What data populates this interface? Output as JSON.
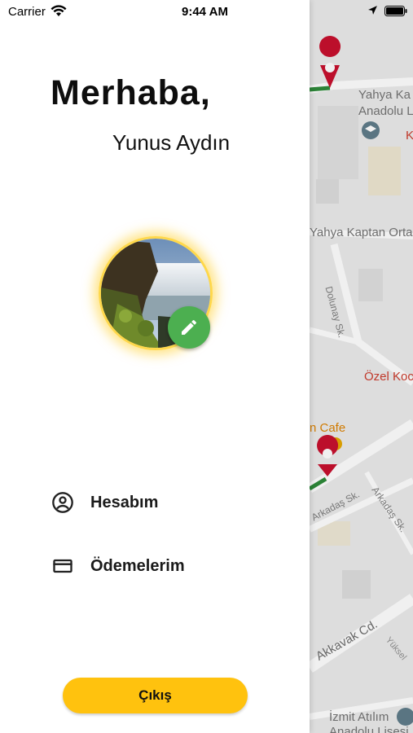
{
  "status_bar": {
    "carrier": "Carrier",
    "time": "9:44 AM",
    "icons": [
      "wifi-icon",
      "location-arrow-icon",
      "battery-icon"
    ]
  },
  "drawer": {
    "greeting": "Merhaba,",
    "user_name": "Yunus Aydın",
    "avatar": {
      "image": "waterfall-photo",
      "edit_icon": "pencil-icon"
    },
    "menu": [
      {
        "label": "Hesabım",
        "icon": "account-circle-icon"
      },
      {
        "label": "Ödemelerim",
        "icon": "credit-card-icon"
      }
    ],
    "logout_label": "Çıkış"
  },
  "map": {
    "labels": {
      "school_1a": "Yahya Ka",
      "school_1b": "Anadolu L",
      "k_red": "K",
      "school_2": "Yahya Kaptan Orta",
      "street_dolunay": "Dolunay Sk.",
      "ozel": "Özel Koc",
      "cafe": "n Cafe",
      "street_arkadas_1": "Arkadaş Sk.",
      "street_arkadas_2": "Arkadaş Sk.",
      "street_akkavak": "Akkavak Cd.",
      "street_yuksel": "Yüksel",
      "school_3a": "İzmit Atılım",
      "school_3b": "Anadolu Lisesi"
    }
  },
  "colors": {
    "accent_yellow": "#ffc20e",
    "edit_green": "#4caf50",
    "map_red": "#c8102e",
    "map_text_red": "#c0392b",
    "map_text_orange": "#d07a00"
  }
}
